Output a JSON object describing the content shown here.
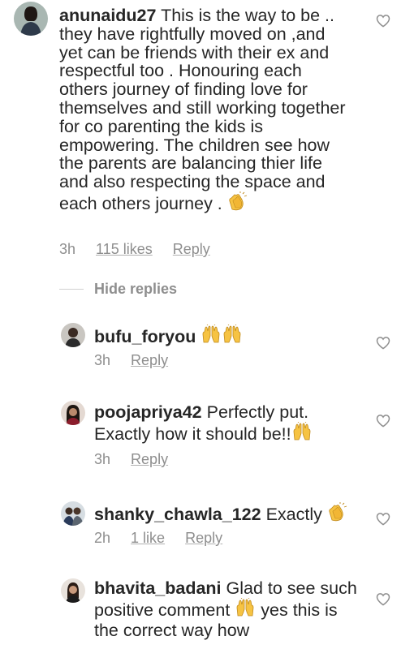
{
  "comment": {
    "username": "anunaidu27",
    "text": "This is the way to be .. they have rightfully  moved on ,and yet can be friends with their ex and respectful too . Honouring each others  journey of finding love for themselves and still  working together for co parenting the  kids is empowering.  The children see how the parents are  balancing thier life and also respecting the space and each others journey .",
    "emoji": "clapping-hands",
    "time": "3h",
    "likes": "115 likes",
    "reply": "Reply"
  },
  "hide_replies": "Hide replies",
  "replies": [
    {
      "username": "bufu_foryou",
      "text": "",
      "emoji": "raising-hands x2",
      "time": "3h",
      "likes": "",
      "reply": "Reply"
    },
    {
      "username": "poojapriya42",
      "text": "Perfectly put. Exactly how it should be!!",
      "emoji": "raising-hands",
      "time": "3h",
      "likes": "",
      "reply": "Reply"
    },
    {
      "username": "shanky_chawla_122",
      "text": "Exactly",
      "emoji": "clapping-hands",
      "time": "2h",
      "likes": "1 like",
      "reply": "Reply"
    },
    {
      "username": "bhavita_badani",
      "text": "Glad to see such positive comment",
      "text2": "yes this is the correct way how",
      "emoji": "raising-hands",
      "time": "",
      "likes": "",
      "reply": ""
    }
  ],
  "colors": {
    "text": "#262626",
    "meta": "#8e8e8e",
    "background": "#ffffff"
  },
  "icons": [
    "heart-outline-icon",
    "clapping-hands-emoji",
    "raising-hands-emoji"
  ]
}
